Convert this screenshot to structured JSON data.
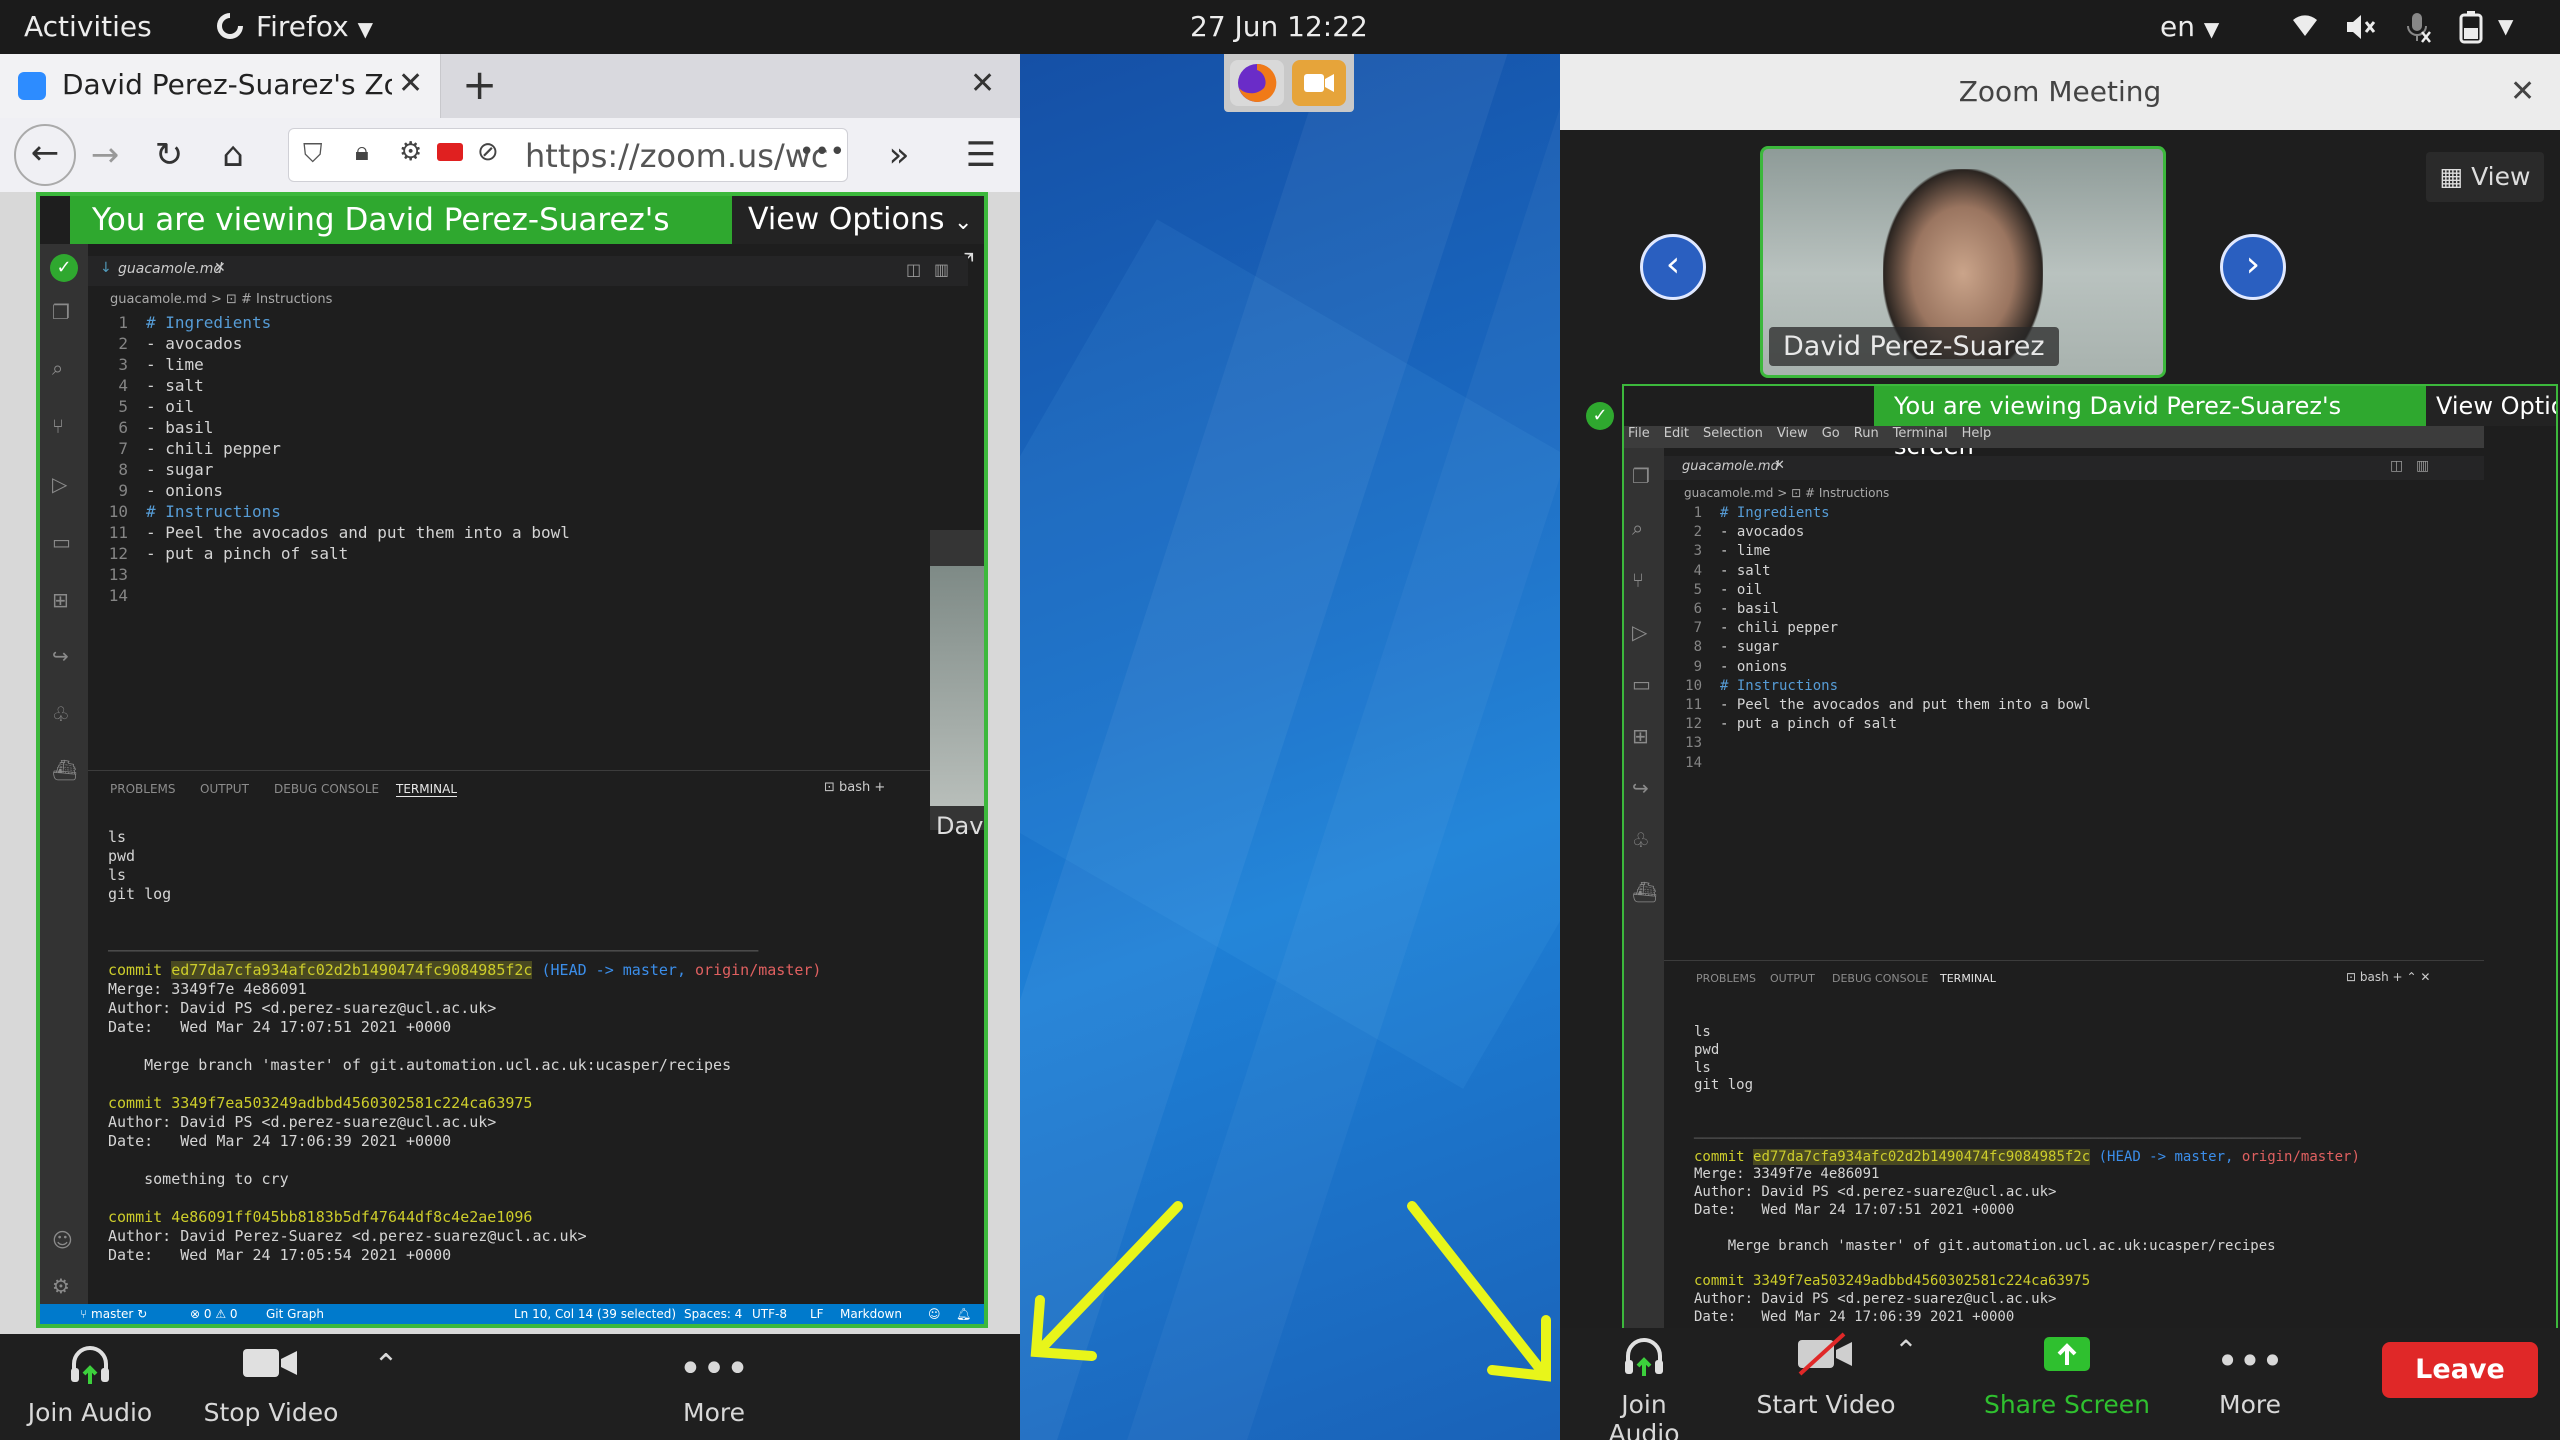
{
  "topbar": {
    "activities": "Activities",
    "app_name": "Firefox",
    "datetime": "27 Jun  12:22",
    "lang": "en"
  },
  "firefox": {
    "tab_title": "David Perez-Suarez's Zoo",
    "url": "https://zoom.us/wc",
    "url_more": "•••"
  },
  "share": {
    "banner_text": "You are viewing David Perez-Suarez's screen",
    "view_options": "View Options",
    "thumb_name": "David P"
  },
  "vscode": {
    "menu": [
      "File",
      "Edit",
      "Selection",
      "View",
      "Go",
      "Run",
      "Terminal",
      "Help"
    ],
    "file_tab": "guacamole.md",
    "breadcrumb": "guacamole.md > ⊡ # Instructions",
    "lines": [
      {
        "n": "1",
        "t": "# Ingredients"
      },
      {
        "n": "2",
        "t": "- avocados"
      },
      {
        "n": "3",
        "t": "- lime"
      },
      {
        "n": "4",
        "t": "- salt"
      },
      {
        "n": "5",
        "t": "- oil"
      },
      {
        "n": "6",
        "t": "- basil"
      },
      {
        "n": "7",
        "t": "- chili pepper"
      },
      {
        "n": "8",
        "t": "- sugar"
      },
      {
        "n": "9",
        "t": "- onions"
      },
      {
        "n": "10",
        "t": "# Instructions"
      },
      {
        "n": "11",
        "t": "- Peel the avocados and put them into a bowl"
      },
      {
        "n": "12",
        "t": "- put a pinch of salt"
      },
      {
        "n": "13",
        "t": ""
      },
      {
        "n": "14",
        "t": ""
      }
    ],
    "panel_tabs": [
      "PROBLEMS",
      "OUTPUT",
      "DEBUG CONSOLE",
      "TERMINAL"
    ],
    "terminal_shell": "bash",
    "terminal_cmds": [
      "ls",
      "pwd",
      "ls",
      "git log"
    ],
    "commit1": {
      "label": "commit",
      "hash": "ed77da7cfa934afc02d2b1490474fc9084985f2c",
      "refs_head": "(HEAD -> master,",
      "refs_origin": "origin/master)",
      "merge": "Merge: 3349f7e 4e86091",
      "author": "Author: David PS <d.perez-suarez@ucl.ac.uk>",
      "date": "Date:   Wed Mar 24 17:07:51 2021 +0000",
      "msg": "    Merge branch 'master' of git.automation.ucl.ac.uk:ucasper/recipes"
    },
    "commit2": {
      "label": "commit",
      "hash": "3349f7ea503249adbbd4560302581c224ca63975",
      "author": "Author: David PS <d.perez-suarez@ucl.ac.uk>",
      "date": "Date:   Wed Mar 24 17:06:39 2021 +0000",
      "msg": "    something to cry"
    },
    "commit3": {
      "label": "commit",
      "hash": "4e86091ff045bb8183b5df47644df8c4e2ae1096",
      "author": "Author: David Perez-Suarez <d.perez-suarez@ucl.ac.uk>",
      "date": "Date:   Wed Mar 24 17:05:54 2021 +0000"
    },
    "status": {
      "branch": "master",
      "problems": "⊗ 0 ⚠ 0",
      "git_graph": "Git Graph",
      "position": "Ln 10, Col 14 (39 selected)",
      "spaces": "Spaces: 4",
      "encoding": "UTF-8",
      "eol": "LF",
      "lang": "Markdown"
    }
  },
  "zoom_left_toolbar": {
    "join_audio": "Join Audio",
    "stop_video": "Stop Video",
    "more": "More"
  },
  "zoom": {
    "title": "Zoom Meeting",
    "view": "View",
    "participant": "David Perez-Suarez",
    "toolbar": {
      "join_audio": "Join Audio",
      "start_video": "Start Video",
      "share_screen": "Share Screen",
      "more": "More",
      "leave": "Leave"
    }
  },
  "colors": {
    "share_green": "#2fa82f",
    "leave_red": "#e02828",
    "arrow_yellow": "#e8f51a",
    "zoom_blue": "#2a5fc0"
  }
}
